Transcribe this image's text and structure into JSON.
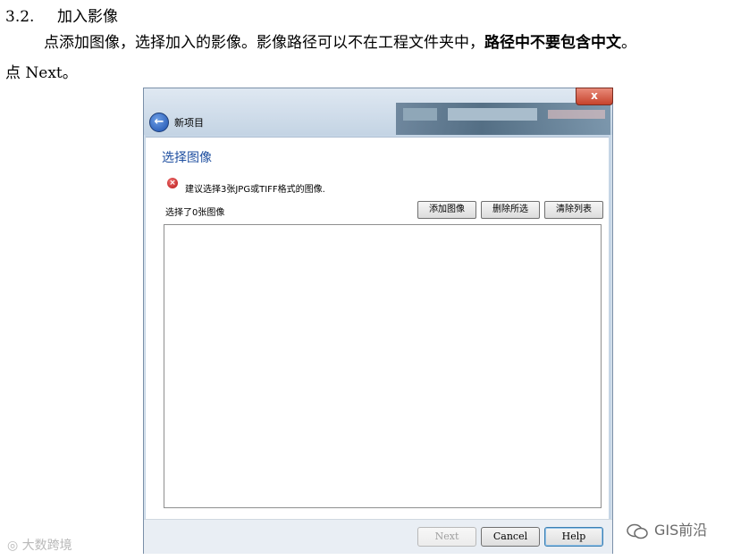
{
  "doc": {
    "heading_number": "3.2.",
    "heading_text": "加入影像",
    "para1_plain": "点添加图像，选择加入的影像。影像路径可以不在工程文件夹中，",
    "para1_bold": "路径中不要包含中文",
    "para1_end": "。",
    "para2": "点 Next。"
  },
  "window": {
    "title": "新项目",
    "close_label": "x"
  },
  "page": {
    "title": "选择图像",
    "error_message": "建议选择3张JPG或TIFF格式的图像.",
    "selected_count": "选择了0张图像",
    "buttons": {
      "add": "添加图像",
      "delete": "删除所选",
      "clear": "清除列表"
    },
    "images": []
  },
  "footer": {
    "next": "Next",
    "cancel": "Cancel",
    "help": "Help"
  },
  "watermarks": {
    "left": "大数跨境",
    "right": "GIS前沿"
  },
  "colors": {
    "accent_title": "#1f4fa0",
    "error_icon": "#c41a1a",
    "close_button": "#c6432c"
  }
}
